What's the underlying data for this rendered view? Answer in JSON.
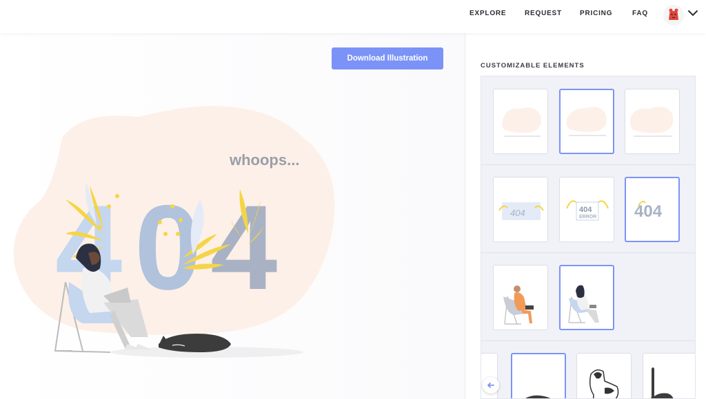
{
  "nav": {
    "items": [
      {
        "label": "EXPLORE"
      },
      {
        "label": "REQUEST"
      },
      {
        "label": "PRICING"
      },
      {
        "label": "FAQ"
      }
    ]
  },
  "actions": {
    "download_label": "Download Illustration"
  },
  "illustration": {
    "caption": "whoops...",
    "big_number": "404"
  },
  "panel": {
    "title": "CUSTOMIZABLE ELEMENTS",
    "tiles": [
      {
        "number": "404"
      },
      {
        "number": "404",
        "subtext": "ERROR"
      },
      {
        "number": "404"
      }
    ]
  },
  "colors": {
    "accent": "#7b93f7",
    "blob": "#fdf0e8",
    "digit_light": "#c5d6ef",
    "digit_dark": "#a8b2c4",
    "leaf_yellow": "#f5d547"
  }
}
